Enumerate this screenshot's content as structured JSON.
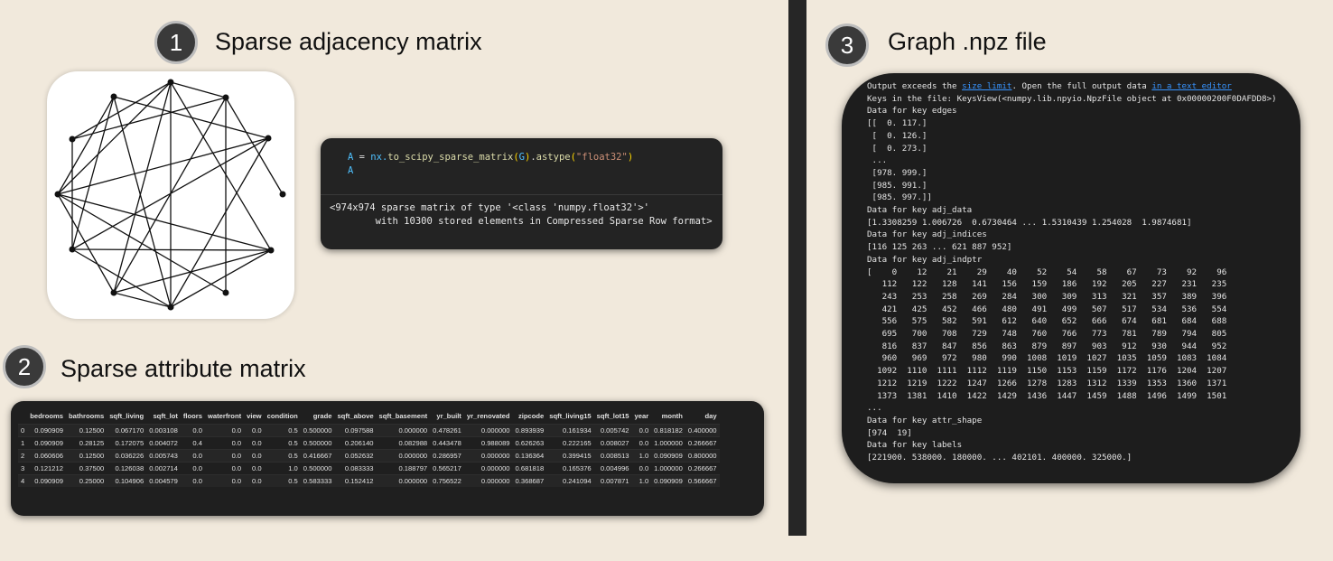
{
  "steps": [
    {
      "number": "1",
      "title": "Sparse adjacency matrix"
    },
    {
      "number": "2",
      "title": "Sparse attribute matrix"
    },
    {
      "number": "3",
      "title": "Graph .npz file"
    }
  ],
  "code_cell": {
    "line1": {
      "var": "A",
      "eq": " = ",
      "mod": "nx.",
      "fn": "to_scipy_sparse_matrix",
      "p1": "(",
      "arg": "G",
      "p2": ")",
      "mid": ".",
      "fn2": "astype",
      "p3": "(",
      "str": "\"float32\"",
      "p4": ")"
    },
    "line2": "A",
    "output_line1": "<974x974 sparse matrix of type '<class 'numpy.float32'>'",
    "output_line2": "        with 10300 stored elements in Compressed Sparse Row format>"
  },
  "attr_table": {
    "headers": [
      "",
      "bedrooms",
      "bathrooms",
      "sqft_living",
      "sqft_lot",
      "floors",
      "waterfront",
      "view",
      "condition",
      "grade",
      "sqft_above",
      "sqft_basement",
      "yr_built",
      "yr_renovated",
      "zipcode",
      "sqft_living15",
      "sqft_lot15",
      "year",
      "month",
      "day"
    ],
    "rows": [
      [
        "0",
        "0.090909",
        "0.12500",
        "0.067170",
        "0.003108",
        "0.0",
        "0.0",
        "0.0",
        "0.5",
        "0.500000",
        "0.097588",
        "0.000000",
        "0.478261",
        "0.000000",
        "0.893939",
        "0.161934",
        "0.005742",
        "0.0",
        "0.818182",
        "0.400000"
      ],
      [
        "1",
        "0.090909",
        "0.28125",
        "0.172075",
        "0.004072",
        "0.4",
        "0.0",
        "0.0",
        "0.5",
        "0.500000",
        "0.206140",
        "0.082988",
        "0.443478",
        "0.988089",
        "0.626263",
        "0.222165",
        "0.008027",
        "0.0",
        "1.000000",
        "0.266667"
      ],
      [
        "2",
        "0.060606",
        "0.12500",
        "0.036226",
        "0.005743",
        "0.0",
        "0.0",
        "0.0",
        "0.5",
        "0.416667",
        "0.052632",
        "0.000000",
        "0.286957",
        "0.000000",
        "0.136364",
        "0.399415",
        "0.008513",
        "1.0",
        "0.090909",
        "0.800000"
      ],
      [
        "3",
        "0.121212",
        "0.37500",
        "0.126038",
        "0.002714",
        "0.0",
        "0.0",
        "0.0",
        "1.0",
        "0.500000",
        "0.083333",
        "0.188797",
        "0.565217",
        "0.000000",
        "0.681818",
        "0.165376",
        "0.004996",
        "0.0",
        "1.000000",
        "0.266667"
      ],
      [
        "4",
        "0.090909",
        "0.25000",
        "0.104906",
        "0.004579",
        "0.0",
        "0.0",
        "0.0",
        "0.5",
        "0.583333",
        "0.152412",
        "0.000000",
        "0.756522",
        "0.000000",
        "0.368687",
        "0.241094",
        "0.007871",
        "1.0",
        "0.090909",
        "0.566667"
      ]
    ]
  },
  "npz_output": {
    "warn_prefix": "Output exceeds the ",
    "warn_link1": "size limit",
    "warn_mid": ". Open the full output data ",
    "warn_link2": "in a text editor",
    "lines": [
      "Keys in the file: KeysView(<numpy.lib.npyio.NpzFile object at 0x00000200F0DAFDD8>)",
      "Data for key edges",
      "[[  0. 117.]",
      " [  0. 126.]",
      " [  0. 273.]",
      " ...",
      " [978. 999.]",
      " [985. 991.]",
      " [985. 997.]]",
      "Data for key adj_data",
      "[1.3308259 1.006726  0.6730464 ... 1.5310439 1.254028  1.9874681]",
      "Data for key adj_indices",
      "[116 125 263 ... 621 887 952]",
      "Data for key adj_indptr",
      "[    0    12    21    29    40    52    54    58    67    73    92    96",
      "   112   122   128   141   156   159   186   192   205   227   231   235",
      "   243   253   258   269   284   300   309   313   321   357   389   396",
      "   421   425   452   466   480   491   499   507   517   534   536   554",
      "   556   575   582   591   612   640   652   666   674   681   684   688",
      "   695   700   708   729   748   760   766   773   781   789   794   805",
      "   816   837   847   856   863   879   897   903   912   930   944   952",
      "   960   969   972   980   990  1008  1019  1027  1035  1059  1083  1084",
      "  1092  1110  1111  1112  1119  1150  1153  1159  1172  1176  1204  1207",
      "  1212  1219  1222  1247  1266  1278  1283  1312  1339  1353  1360  1371",
      "  1373  1381  1410  1422  1429  1436  1447  1459  1488  1496  1499  1501",
      "...",
      "Data for key attr_shape",
      "[974  19]",
      "Data for key labels",
      "[221900. 538000. 180000. ... 402101. 400000. 325000.]"
    ]
  },
  "colors": {
    "background": "#f1e9dc",
    "badge": "#3a3a3a",
    "panel": "#1f1f1f",
    "link": "#3794ff"
  }
}
